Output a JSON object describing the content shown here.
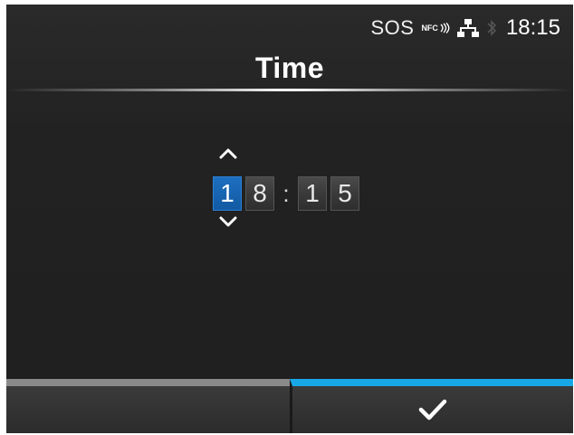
{
  "status_bar": {
    "sos_label": "SOS",
    "nfc_label": "NFC",
    "time": "18:15",
    "icons": [
      "nfc-icon",
      "network-icon",
      "bluetooth-icon"
    ]
  },
  "header": {
    "title": "Time"
  },
  "time_editor": {
    "digits": [
      "1",
      "8",
      "1",
      "5"
    ],
    "separator": ":",
    "selected_digit_index": 0,
    "up_icon": "chevron-up-icon",
    "down_icon": "chevron-down-icon"
  },
  "buttons": {
    "left": {
      "label": ""
    },
    "right": {
      "icon": "checkmark-icon"
    }
  },
  "colors": {
    "accent": "#18a8e8",
    "selected_digit": "#1d6fc0",
    "background": "#222222",
    "left_button_bar": "#8a8a8a"
  }
}
